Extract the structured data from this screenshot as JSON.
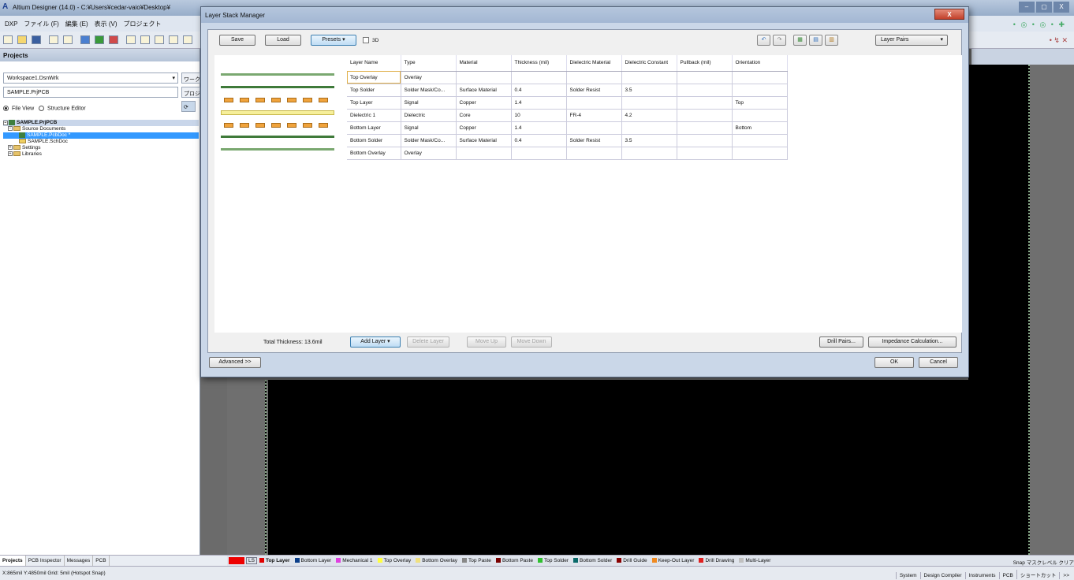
{
  "main_window": {
    "title": "Altium Designer (14.0) - C:¥Users¥cedar-vaio¥Desktop¥",
    "menu": [
      "DXP",
      "ファイル (F)",
      "編集 (E)",
      "表示 (V)",
      "プロジェクト"
    ],
    "window_buttons": [
      "–",
      "▢",
      "X"
    ]
  },
  "projects_panel": {
    "title": "Projects",
    "workspace_combo": "Workspace1.DsnWrk",
    "workspace_button": "ワークス",
    "project_combo": "SAMPLE.PrjPCB",
    "project_button": "プロジェ",
    "view_options": {
      "file_view": "File View",
      "structure_editor": "Structure Editor"
    },
    "tree": {
      "project": "SAMPLE.PrjPCB",
      "source_documents": "Source Documents",
      "pcb_doc": "SAMPLE.PcbDoc *",
      "sch_doc": "SAMPLE.SchDoc",
      "settings": "Settings",
      "libraries": "Libraries"
    },
    "tabs": [
      "Projects",
      "PCB Inspector",
      "Messages",
      "PCB"
    ]
  },
  "dialog": {
    "title": "Layer Stack Manager",
    "close_label": "X",
    "toolbar": {
      "save": "Save",
      "load": "Load",
      "presets": "Presets",
      "three_d": "3D",
      "layer_pairs": "Layer Pairs"
    },
    "table": {
      "headers": [
        "Layer Name",
        "Type",
        "Material",
        "Thickness (mil)",
        "Dielectric Material",
        "Dielectric Constant",
        "Pullback (mil)",
        "Orientation"
      ],
      "rows": [
        [
          "Top Overlay",
          "Overlay",
          "",
          "",
          "",
          "",
          "",
          ""
        ],
        [
          "Top Solder",
          "Solder Mask/Co...",
          "Surface Material",
          "0.4",
          "Solder Resist",
          "3.5",
          "",
          ""
        ],
        [
          "Top Layer",
          "Signal",
          "Copper",
          "1.4",
          "",
          "",
          "",
          "Top"
        ],
        [
          "Dielectric 1",
          "Dielectric",
          "Core",
          "10",
          "FR-4",
          "4.2",
          "",
          ""
        ],
        [
          "Bottom Layer",
          "Signal",
          "Copper",
          "1.4",
          "",
          "",
          "",
          "Bottom"
        ],
        [
          "Bottom Solder",
          "Solder Mask/Co...",
          "Surface Material",
          "0.4",
          "Solder Resist",
          "3.5",
          "",
          ""
        ],
        [
          "Bottom Overlay",
          "Overlay",
          "",
          "",
          "",
          "",
          "",
          ""
        ]
      ]
    },
    "footer": {
      "total_thickness": "Total Thickness: 13.6mil",
      "add_layer": "Add Layer",
      "delete_layer": "Delete Layer",
      "move_up": "Move Up",
      "move_down": "Move Down",
      "drill_pairs": "Drill Pairs...",
      "impedance_calculation": "Impedance Calculation...",
      "advanced": "Advanced >>",
      "ok": "OK",
      "cancel": "Cancel"
    }
  },
  "layer_tabs": {
    "ls": "LS",
    "layers": [
      {
        "name": "Top Layer",
        "color": "#e00000",
        "active": true
      },
      {
        "name": "Bottom Layer",
        "color": "#0b3f8a"
      },
      {
        "name": "Mechanical 1",
        "color": "#e040e0"
      },
      {
        "name": "Top Overlay",
        "color": "#ffff40"
      },
      {
        "name": "Bottom Overlay",
        "color": "#f0e080"
      },
      {
        "name": "Top Paste",
        "color": "#888888"
      },
      {
        "name": "Bottom Paste",
        "color": "#7a0000"
      },
      {
        "name": "Top Solder",
        "color": "#30c030"
      },
      {
        "name": "Bottom Solder",
        "color": "#0a6a6a"
      },
      {
        "name": "Drill Guide",
        "color": "#8a0000"
      },
      {
        "name": "Keep-Out Layer",
        "color": "#f08a20"
      },
      {
        "name": "Drill Drawing",
        "color": "#e02020"
      },
      {
        "name": "Multi-Layer",
        "color": "#c0c0c0"
      }
    ],
    "right": "Snap マスクレベル クリア"
  },
  "statusbar": {
    "coords": "X:865mil Y:4850mil  Grid: 5mil   (Hotspot Snap)",
    "right_items": [
      "System",
      "Design Compiler",
      "Instruments",
      "PCB",
      "ショートカット",
      ">>"
    ]
  },
  "colors": {
    "title_gradient": "#a3b7d3",
    "selection": "#3399ff",
    "pad_orange": "#f0a33c",
    "copper_green": "#5f9f5f"
  }
}
